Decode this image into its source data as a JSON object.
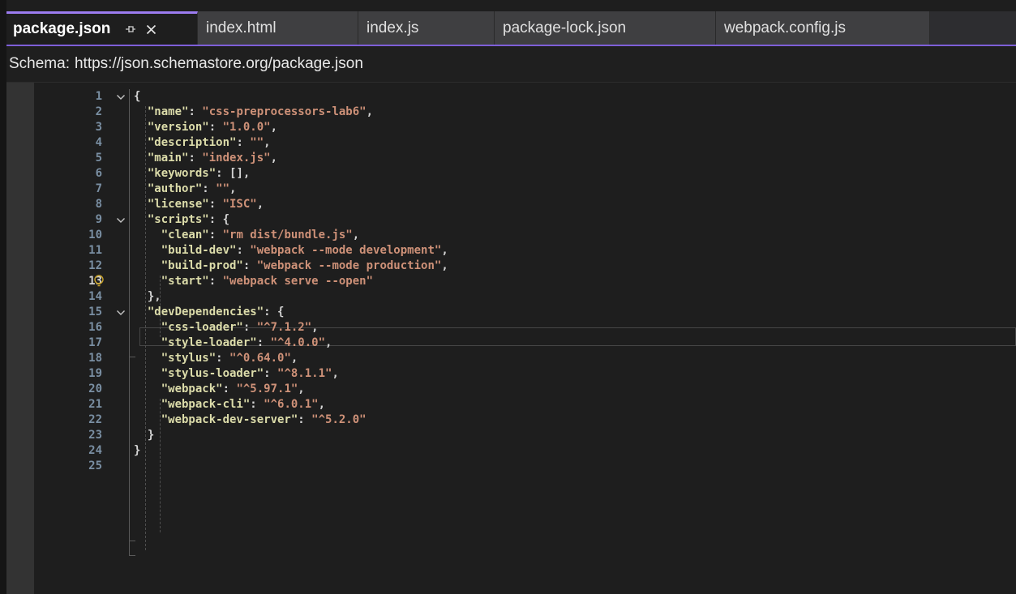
{
  "tabs": [
    {
      "label": "package.json",
      "active": true
    },
    {
      "label": "index.html"
    },
    {
      "label": "index.js"
    },
    {
      "label": "package-lock.json"
    },
    {
      "label": "webpack.config.js"
    }
  ],
  "icons": {
    "pin": "pin-icon",
    "close": "close-icon",
    "fold": "chevron-down-icon",
    "lightbulb": "lightbulb-icon"
  },
  "colors": {
    "accent": "#9c7cf0",
    "key": "#dcdcaa",
    "string": "#ce9178",
    "line_number": "#7a8fa3"
  },
  "schema": {
    "label": "Schema:",
    "url": "https://json.schemastore.org/package.json"
  },
  "editor": {
    "current_line": 13,
    "lines": [
      [
        {
          "t": "p",
          "v": "{"
        }
      ],
      [
        {
          "t": "k",
          "v": "\"name\""
        },
        {
          "t": "p",
          "v": ": "
        },
        {
          "t": "s",
          "v": "\"css-preprocessors-lab6\""
        },
        {
          "t": "p",
          "v": ","
        }
      ],
      [
        {
          "t": "k",
          "v": "\"version\""
        },
        {
          "t": "p",
          "v": ": "
        },
        {
          "t": "s",
          "v": "\"1.0.0\""
        },
        {
          "t": "p",
          "v": ","
        }
      ],
      [
        {
          "t": "k",
          "v": "\"description\""
        },
        {
          "t": "p",
          "v": ": "
        },
        {
          "t": "s",
          "v": "\"\""
        },
        {
          "t": "p",
          "v": ","
        }
      ],
      [
        {
          "t": "k",
          "v": "\"main\""
        },
        {
          "t": "p",
          "v": ": "
        },
        {
          "t": "s",
          "v": "\"index.js\""
        },
        {
          "t": "p",
          "v": ","
        }
      ],
      [
        {
          "t": "k",
          "v": "\"keywords\""
        },
        {
          "t": "p",
          "v": ": [],"
        }
      ],
      [
        {
          "t": "k",
          "v": "\"author\""
        },
        {
          "t": "p",
          "v": ": "
        },
        {
          "t": "s",
          "v": "\"\""
        },
        {
          "t": "p",
          "v": ","
        }
      ],
      [
        {
          "t": "k",
          "v": "\"license\""
        },
        {
          "t": "p",
          "v": ": "
        },
        {
          "t": "s",
          "v": "\"ISC\""
        },
        {
          "t": "p",
          "v": ","
        }
      ],
      [
        {
          "t": "k",
          "v": "\"scripts\""
        },
        {
          "t": "p",
          "v": ": {"
        }
      ],
      [
        {
          "t": "k",
          "v": "\"clean\""
        },
        {
          "t": "p",
          "v": ": "
        },
        {
          "t": "s",
          "v": "\"rm dist/bundle.js\""
        },
        {
          "t": "p",
          "v": ","
        }
      ],
      [
        {
          "t": "k",
          "v": "\"build-dev\""
        },
        {
          "t": "p",
          "v": ": "
        },
        {
          "t": "s",
          "v": "\"webpack --mode development\""
        },
        {
          "t": "p",
          "v": ","
        }
      ],
      [
        {
          "t": "k",
          "v": "\"build-prod\""
        },
        {
          "t": "p",
          "v": ": "
        },
        {
          "t": "s",
          "v": "\"webpack --mode production\""
        },
        {
          "t": "p",
          "v": ","
        }
      ],
      [
        {
          "t": "k",
          "v": "\"start\""
        },
        {
          "t": "p",
          "v": ": "
        },
        {
          "t": "s",
          "v": "\"webpack serve --open\""
        }
      ],
      [
        {
          "t": "p",
          "v": "},"
        }
      ],
      [
        {
          "t": "k",
          "v": "\"devDependencies\""
        },
        {
          "t": "p",
          "v": ": {"
        }
      ],
      [
        {
          "t": "k",
          "v": "\"css-loader\""
        },
        {
          "t": "p",
          "v": ": "
        },
        {
          "t": "s",
          "v": "\"^7.1.2\""
        },
        {
          "t": "p",
          "v": ","
        }
      ],
      [
        {
          "t": "k",
          "v": "\"style-loader\""
        },
        {
          "t": "p",
          "v": ": "
        },
        {
          "t": "s",
          "v": "\"^4.0.0\""
        },
        {
          "t": "p",
          "v": ","
        }
      ],
      [
        {
          "t": "k",
          "v": "\"stylus\""
        },
        {
          "t": "p",
          "v": ": "
        },
        {
          "t": "s",
          "v": "\"^0.64.0\""
        },
        {
          "t": "p",
          "v": ","
        }
      ],
      [
        {
          "t": "k",
          "v": "\"stylus-loader\""
        },
        {
          "t": "p",
          "v": ": "
        },
        {
          "t": "s",
          "v": "\"^8.1.1\""
        },
        {
          "t": "p",
          "v": ","
        }
      ],
      [
        {
          "t": "k",
          "v": "\"webpack\""
        },
        {
          "t": "p",
          "v": ": "
        },
        {
          "t": "s",
          "v": "\"^5.97.1\""
        },
        {
          "t": "p",
          "v": ","
        }
      ],
      [
        {
          "t": "k",
          "v": "\"webpack-cli\""
        },
        {
          "t": "p",
          "v": ": "
        },
        {
          "t": "s",
          "v": "\"^6.0.1\""
        },
        {
          "t": "p",
          "v": ","
        }
      ],
      [
        {
          "t": "k",
          "v": "\"webpack-dev-server\""
        },
        {
          "t": "p",
          "v": ": "
        },
        {
          "t": "s",
          "v": "\"^5.2.0\""
        }
      ],
      [
        {
          "t": "p",
          "v": "}"
        }
      ],
      [
        {
          "t": "p",
          "v": "}"
        }
      ],
      []
    ]
  }
}
